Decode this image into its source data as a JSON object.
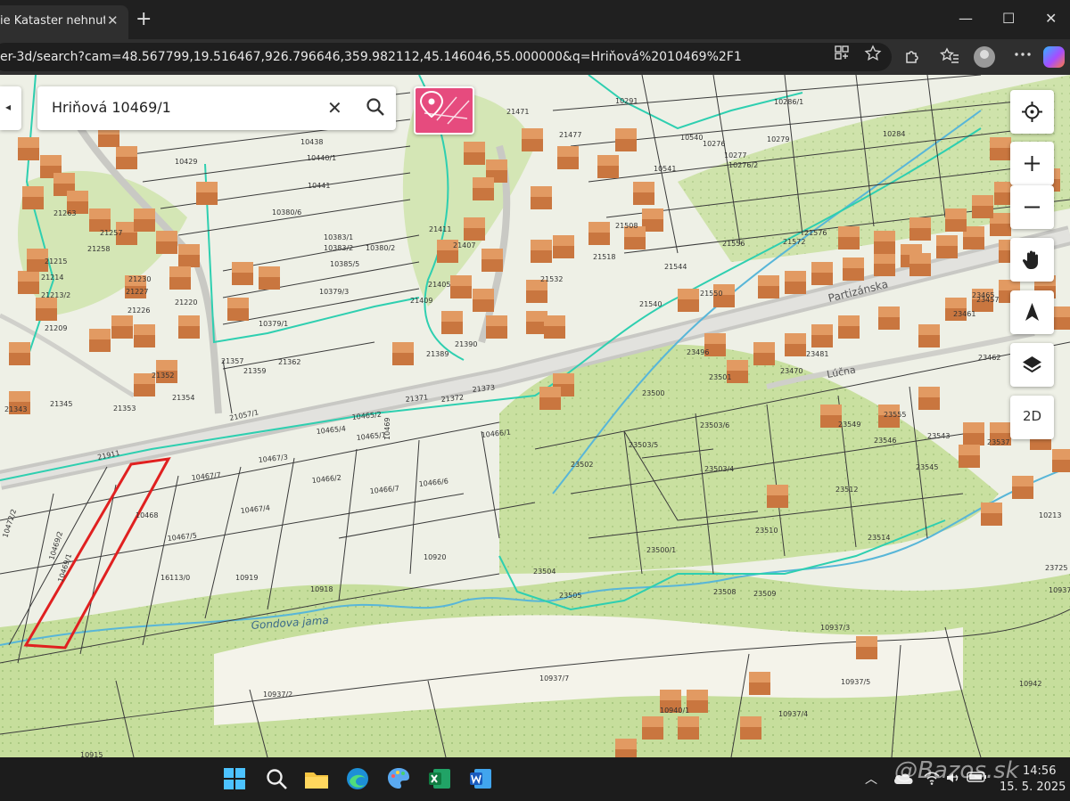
{
  "browser": {
    "tab_title": "ie Kataster nehnuteľnos",
    "tab_close": "✕",
    "new_tab": "+",
    "url": "er-3d/search?cam=48.567799,19.516467,926.796646,359.982112,45.146046,55.000000&q=Hriňová%2010469%2F1",
    "minimize": "—",
    "maximize": "☐",
    "close": "✕"
  },
  "search": {
    "collapse_glyph": "◂",
    "query": "Hriňová 10469/1",
    "clear_glyph": "✕"
  },
  "controls": {
    "mode_2d": "2D"
  },
  "map": {
    "place_labels": [
      "Partizánska",
      "Lúčna",
      "Gondova jama"
    ],
    "parcel_labels": [
      {
        "t": "10469/1"
      },
      {
        "t": "10469/2"
      },
      {
        "t": "10468"
      },
      {
        "t": "10467/5"
      },
      {
        "t": "10467/4"
      },
      {
        "t": "10467/7"
      },
      {
        "t": "10467/3"
      },
      {
        "t": "10466/2"
      },
      {
        "t": "10466/7"
      },
      {
        "t": "10466/6"
      },
      {
        "t": "10466/1"
      },
      {
        "t": "10465/4"
      },
      {
        "t": "10465/1"
      },
      {
        "t": "10469"
      },
      {
        "t": "10465/2"
      },
      {
        "t": "21373"
      },
      {
        "t": "21371"
      },
      {
        "t": "21372"
      },
      {
        "t": "21057/1"
      },
      {
        "t": "21354"
      },
      {
        "t": "21353"
      },
      {
        "t": "21345"
      },
      {
        "t": "21343"
      },
      {
        "t": "21352"
      },
      {
        "t": "21357"
      },
      {
        "t": "21359"
      },
      {
        "t": "21362"
      },
      {
        "t": "21390"
      },
      {
        "t": "21389"
      },
      {
        "t": "21409"
      },
      {
        "t": "21405"
      },
      {
        "t": "21407"
      },
      {
        "t": "21411"
      },
      {
        "t": "21532"
      },
      {
        "t": "21518"
      },
      {
        "t": "21508"
      },
      {
        "t": "21540"
      },
      {
        "t": "21550"
      },
      {
        "t": "21544"
      },
      {
        "t": "21556"
      },
      {
        "t": "21572"
      },
      {
        "t": "21576"
      },
      {
        "t": "21477"
      },
      {
        "t": "21471"
      },
      {
        "t": "21209"
      },
      {
        "t": "21226"
      },
      {
        "t": "21227"
      },
      {
        "t": "21230"
      },
      {
        "t": "21220"
      },
      {
        "t": "21213/2"
      },
      {
        "t": "21214"
      },
      {
        "t": "21215"
      },
      {
        "t": "21257"
      },
      {
        "t": "21258"
      },
      {
        "t": "21263"
      },
      {
        "t": "10438"
      },
      {
        "t": "10440/1"
      },
      {
        "t": "10441"
      },
      {
        "t": "10429"
      },
      {
        "t": "10380/6"
      },
      {
        "t": "10383/1"
      },
      {
        "t": "10383/2"
      },
      {
        "t": "10385/5"
      },
      {
        "t": "10380/2"
      },
      {
        "t": "10379/3"
      },
      {
        "t": "10379/1"
      },
      {
        "t": "10541"
      },
      {
        "t": "10540"
      },
      {
        "t": "10276"
      },
      {
        "t": "10277"
      },
      {
        "t": "10276/2"
      },
      {
        "t": "10279"
      },
      {
        "t": "10291"
      },
      {
        "t": "10286/1"
      },
      {
        "t": "10284"
      },
      {
        "t": "23500"
      },
      {
        "t": "23501"
      },
      {
        "t": "23496"
      },
      {
        "t": "23503/6"
      },
      {
        "t": "23503/5"
      },
      {
        "t": "23503/4"
      },
      {
        "t": "23502"
      },
      {
        "t": "23512"
      },
      {
        "t": "23510"
      },
      {
        "t": "23514"
      },
      {
        "t": "23500/1"
      },
      {
        "t": "23504"
      },
      {
        "t": "23505"
      },
      {
        "t": "23509"
      },
      {
        "t": "23508"
      },
      {
        "t": "23462"
      },
      {
        "t": "23461"
      },
      {
        "t": "23465"
      },
      {
        "t": "23457"
      },
      {
        "t": "23470"
      },
      {
        "t": "23549"
      },
      {
        "t": "23546"
      },
      {
        "t": "23543"
      },
      {
        "t": "23537"
      },
      {
        "t": "23545"
      },
      {
        "t": "23555"
      },
      {
        "t": "23481"
      },
      {
        "t": "10920"
      },
      {
        "t": "10919"
      },
      {
        "t": "10918"
      },
      {
        "t": "16113/0"
      },
      {
        "t": "10937/3"
      },
      {
        "t": "10937/7"
      },
      {
        "t": "10937/2"
      },
      {
        "t": "10937/5"
      },
      {
        "t": "10937/4"
      },
      {
        "t": "10940/1"
      },
      {
        "t": "10942"
      },
      {
        "t": "10915"
      },
      {
        "t": "10937"
      },
      {
        "t": "10213"
      },
      {
        "t": "23725"
      },
      {
        "t": "10472/2"
      },
      {
        "t": "21911"
      }
    ]
  },
  "taskbar": {
    "time": "14:56",
    "date": "15. 5. 2025"
  },
  "watermark": "@Bazos.sk",
  "colors": {
    "accent_marker": "#e64b7e",
    "selection_outline": "#e02020",
    "cadastre_boundary": "#2ecfb0",
    "forest": "#c6de9c",
    "building": "#d98a52"
  }
}
